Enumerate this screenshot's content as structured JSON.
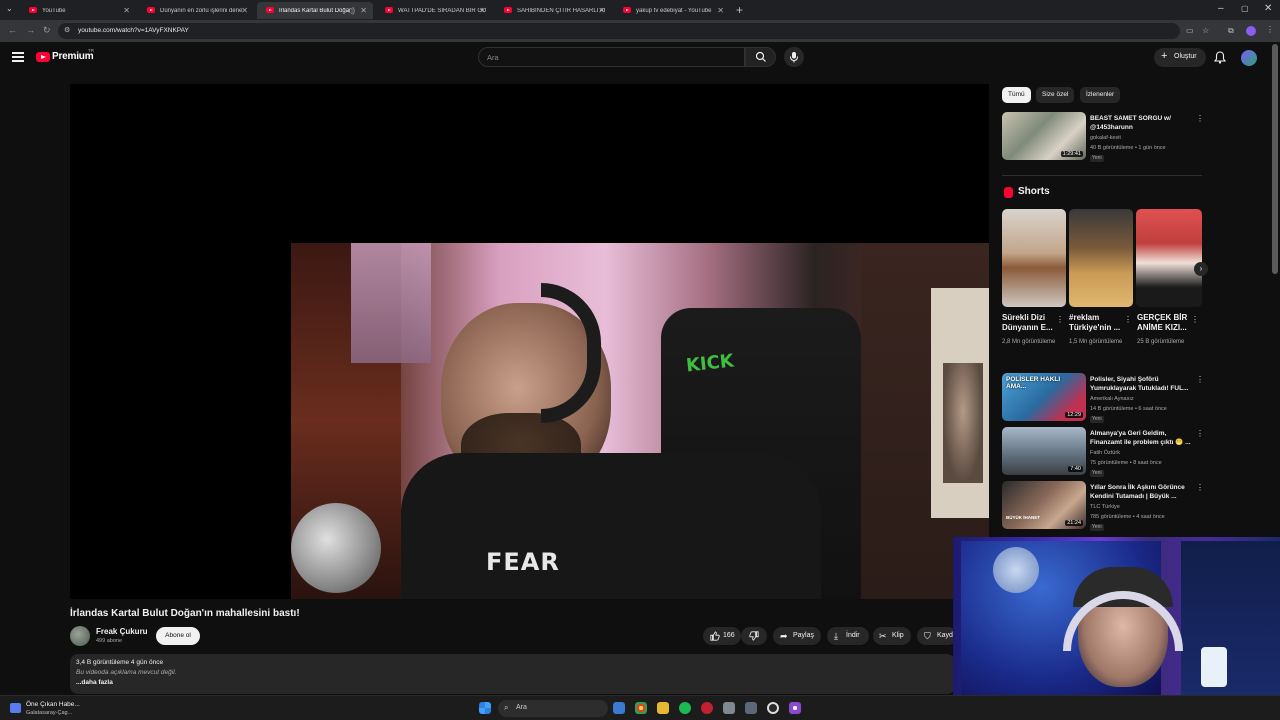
{
  "browser": {
    "tabs": [
      {
        "label": "YouTube",
        "active": false
      },
      {
        "label": "Dünyanın en zorlu işlerini dene",
        "active": false
      },
      {
        "label": "İrlandas Kartal Bulut Doğan",
        "active": true
      },
      {
        "label": "WATTPAD'DE SIRADAN BİR GÜ",
        "active": false
      },
      {
        "label": "SAHİBİNDEN ÇİTİR HASARLI AR",
        "active": false
      },
      {
        "label": "yakup tv edebiyat - YouTube",
        "active": false
      }
    ],
    "url": "youtube.com/watch?v=1AVyFXNKPAY"
  },
  "header": {
    "brand": "Premium",
    "brand_region": "TR",
    "search_placeholder": "Ara",
    "create_label": "Oluştur"
  },
  "video": {
    "title": "İrlandas Kartal Bulut Doğan'ın mahallesini bastı!",
    "channel_name": "Freak Çukuru",
    "subscribers": "499 abone",
    "subscribe_label": "Abone ol",
    "likes": "166",
    "share_label": "Paylaş",
    "download_label": "İndir",
    "clip_label": "Klip",
    "save_label": "Kaydet",
    "stats": "3,4 B görüntüleme  4 gün önce",
    "description": "Bu videoda açıklama mevcut değil.",
    "more_label": "...daha fazla",
    "shirt_text": "FEAR",
    "chair_text": "KICK"
  },
  "sidebar": {
    "chips": [
      {
        "label": "Tümü",
        "selected": true
      },
      {
        "label": "Size özel",
        "selected": false
      },
      {
        "label": "İzlenenler",
        "selected": false
      }
    ],
    "top_video": {
      "title": "BEAST SAMET SORGU w/ @1453harunn",
      "channel": "gokalaf-kesit",
      "meta": "40 B görüntüleme • 1 gün önce",
      "badge": "Yeni",
      "duration": "1:29:41"
    },
    "shorts_header": "Shorts",
    "shorts": [
      {
        "title": "Sürekli Dizi Dünyanın E...",
        "views": "2,8 Mn görüntüleme"
      },
      {
        "title": "#reklam Türkiye'nin ...",
        "views": "1,5 Mn görüntüleme"
      },
      {
        "title": "GERÇEK BİR ANİME KIZI...",
        "views": "25 B görüntüleme"
      }
    ],
    "videos": [
      {
        "title": "Polisler, Siyahi Şoförü Yumruklayarak Tutukladı! FUL...",
        "channel": "Amerikalı Aynasız",
        "meta": "14 B görüntüleme • 6 saat önce",
        "badge": "Yeni",
        "duration": "12:29",
        "thumb_text": "POLİSLER HAKLI AMA..."
      },
      {
        "title": "Almanya'ya Geri Geldim, Finanzamt ile problem çıktı 😬 ...",
        "channel": "Fatih Öztürk",
        "meta": "75 görüntüleme • 8 saat önce",
        "badge": "Yeni",
        "duration": "7:40",
        "thumb_text": ""
      },
      {
        "title": "Yıllar Sonra İlk Aşkını Görünce Kendini Tutamadı | Büyük ...",
        "channel": "TLC Türkiye",
        "meta": "785 görüntüleme • 4 saat önce",
        "badge": "Yeni",
        "duration": "21:24",
        "thumb_text": "BÜYÜK İHANET"
      }
    ]
  },
  "taskbar": {
    "news_title": "Öne Çıkan Habe...",
    "news_sub": "Galatasaray-Çag...",
    "search_label": "Ara"
  },
  "colors": {
    "yt_red": "#ff0033",
    "background": "#0f0f0f",
    "chip_bg": "#272727"
  }
}
